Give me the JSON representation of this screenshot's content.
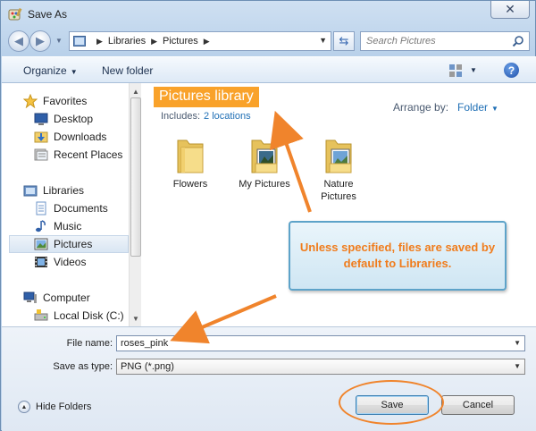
{
  "window": {
    "title": "Save As",
    "close_label": "✕"
  },
  "nav": {
    "breadcrumbs": [
      "Libraries",
      "Pictures"
    ],
    "search_placeholder": "Search Pictures"
  },
  "toolbar": {
    "organize": "Organize",
    "new_folder": "New folder",
    "help": "?"
  },
  "sidebar": {
    "items": [
      {
        "label": "Favorites",
        "icon": "star-icon"
      },
      {
        "label": "Desktop",
        "icon": "desktop-icon"
      },
      {
        "label": "Downloads",
        "icon": "downloads-icon"
      },
      {
        "label": "Recent Places",
        "icon": "recent-places-icon"
      },
      {
        "label": "Libraries",
        "icon": "libraries-icon"
      },
      {
        "label": "Documents",
        "icon": "documents-icon"
      },
      {
        "label": "Music",
        "icon": "music-icon"
      },
      {
        "label": "Pictures",
        "icon": "pictures-icon",
        "selected": true
      },
      {
        "label": "Videos",
        "icon": "videos-icon"
      },
      {
        "label": "Computer",
        "icon": "computer-icon"
      },
      {
        "label": "Local Disk (C:)",
        "icon": "local-disk-icon"
      }
    ]
  },
  "main": {
    "library_title": "Pictures library",
    "includes_label": "Includes:",
    "includes_link": "2 locations",
    "arrange_label": "Arrange by:",
    "arrange_value": "Folder",
    "folders": [
      {
        "line1": "Flowers",
        "line2": ""
      },
      {
        "line1": "My Pictures",
        "line2": ""
      },
      {
        "line1": "Nature",
        "line2": "Pictures"
      }
    ]
  },
  "callout": {
    "text": "Unless specified, files are saved by default to Libraries."
  },
  "form": {
    "file_name_label": "File name:",
    "file_name_value": "roses_pink",
    "save_type_label": "Save as type:",
    "save_type_value": "PNG (*.png)"
  },
  "footer": {
    "hide_folders": "Hide Folders",
    "save": "Save",
    "cancel": "Cancel"
  },
  "colors": {
    "annotation": "#f0842c",
    "library_header_bg": "#f9a22a",
    "link": "#1f6fb5"
  }
}
